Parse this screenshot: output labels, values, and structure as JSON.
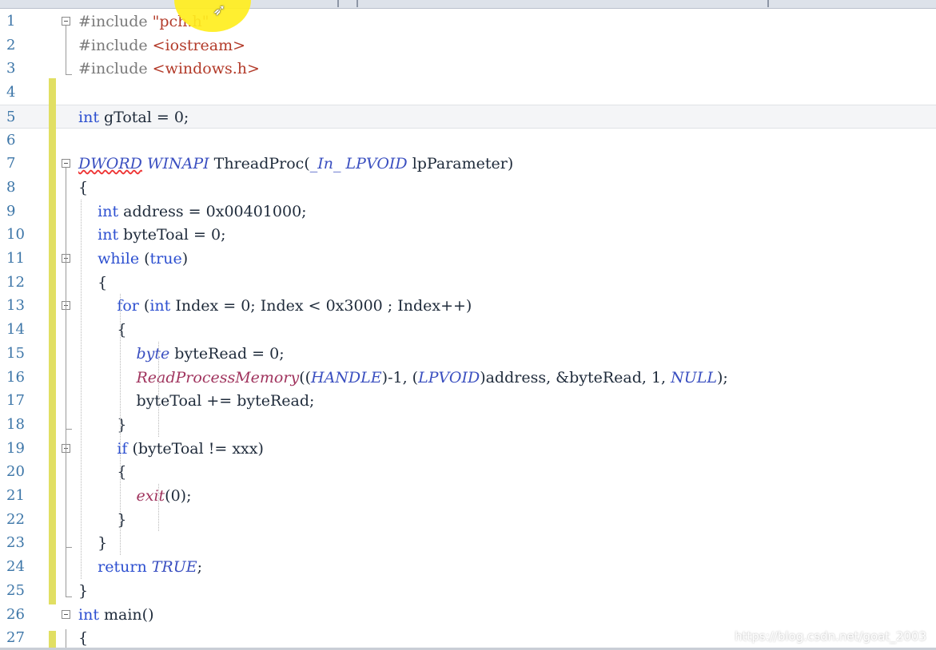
{
  "editor": {
    "lines": [
      {
        "n": "1",
        "t": [
          [
            "pp",
            "#include "
          ],
          [
            "str",
            "\"pch.h\""
          ]
        ]
      },
      {
        "n": "2",
        "t": [
          [
            "pp",
            "#include "
          ],
          [
            "str",
            "<iostream>"
          ]
        ]
      },
      {
        "n": "3",
        "t": [
          [
            "pp",
            "#include "
          ],
          [
            "str",
            "<windows.h>"
          ]
        ]
      },
      {
        "n": "4",
        "t": []
      },
      {
        "n": "5",
        "t": [
          [
            "kw",
            "int"
          ],
          [
            "punc",
            " gTotal = 0;"
          ]
        ]
      },
      {
        "n": "6",
        "t": []
      },
      {
        "n": "7",
        "t": [
          [
            "mac",
            "DWORD"
          ],
          [
            "punc",
            " "
          ],
          [
            "mac",
            "WINAPI"
          ],
          [
            "punc",
            " ThreadProc("
          ],
          [
            "mac",
            "_In_"
          ],
          [
            "punc",
            " "
          ],
          [
            "mac",
            "LPVOID"
          ],
          [
            "punc",
            " lpParameter)"
          ]
        ]
      },
      {
        "n": "8",
        "t": [
          [
            "punc",
            "{"
          ]
        ]
      },
      {
        "n": "9",
        "t": [
          [
            "punc",
            "    "
          ],
          [
            "kw",
            "int"
          ],
          [
            "punc",
            " address = 0x00401000;"
          ]
        ]
      },
      {
        "n": "10",
        "t": [
          [
            "punc",
            "    "
          ],
          [
            "kw",
            "int"
          ],
          [
            "punc",
            " byteToal = 0;"
          ]
        ]
      },
      {
        "n": "11",
        "t": [
          [
            "punc",
            "    "
          ],
          [
            "kw",
            "while"
          ],
          [
            "punc",
            " ("
          ],
          [
            "kw",
            "true"
          ],
          [
            "punc",
            ")"
          ]
        ]
      },
      {
        "n": "12",
        "t": [
          [
            "punc",
            "    {"
          ]
        ]
      },
      {
        "n": "13",
        "t": [
          [
            "punc",
            "        "
          ],
          [
            "kw",
            "for"
          ],
          [
            "punc",
            " ("
          ],
          [
            "kw",
            "int"
          ],
          [
            "punc",
            " Index = 0; Index < 0x3000 ; Index++)"
          ]
        ]
      },
      {
        "n": "14",
        "t": [
          [
            "punc",
            "        {"
          ]
        ]
      },
      {
        "n": "15",
        "t": [
          [
            "punc",
            "            "
          ],
          [
            "mac",
            "byte"
          ],
          [
            "punc",
            " byteRead = 0;"
          ]
        ]
      },
      {
        "n": "16",
        "t": [
          [
            "punc",
            "            "
          ],
          [
            "fn",
            "ReadProcessMemory"
          ],
          [
            "punc",
            "(("
          ],
          [
            "mac",
            "HANDLE"
          ],
          [
            "punc",
            ")-1, ("
          ],
          [
            "mac",
            "LPVOID"
          ],
          [
            "punc",
            ")address, &byteRead, 1, "
          ],
          [
            "mac",
            "NULL"
          ],
          [
            "punc",
            ");"
          ]
        ]
      },
      {
        "n": "17",
        "t": [
          [
            "punc",
            "            byteToal += byteRead;"
          ]
        ]
      },
      {
        "n": "18",
        "t": [
          [
            "punc",
            "        }"
          ]
        ]
      },
      {
        "n": "19",
        "t": [
          [
            "punc",
            "        "
          ],
          [
            "kw",
            "if"
          ],
          [
            "punc",
            " (byteToal != xxx)"
          ]
        ]
      },
      {
        "n": "20",
        "t": [
          [
            "punc",
            "        {"
          ]
        ]
      },
      {
        "n": "21",
        "t": [
          [
            "punc",
            "            "
          ],
          [
            "fn",
            "exit"
          ],
          [
            "punc",
            "(0);"
          ]
        ]
      },
      {
        "n": "22",
        "t": [
          [
            "punc",
            "        }"
          ]
        ]
      },
      {
        "n": "23",
        "t": [
          [
            "punc",
            "    }"
          ]
        ]
      },
      {
        "n": "24",
        "t": [
          [
            "punc",
            "    "
          ],
          [
            "kw",
            "return"
          ],
          [
            "punc",
            " "
          ],
          [
            "mac",
            "TRUE"
          ],
          [
            "punc",
            ";"
          ]
        ]
      },
      {
        "n": "25",
        "t": [
          [
            "punc",
            "}"
          ]
        ]
      },
      {
        "n": "26",
        "t": [
          [
            "kw",
            "int"
          ],
          [
            "punc",
            " main()"
          ]
        ]
      },
      {
        "n": "27",
        "t": [
          [
            "punc",
            "{"
          ]
        ]
      }
    ]
  },
  "watermark": "https://blog.csdn.net/goat_2003"
}
